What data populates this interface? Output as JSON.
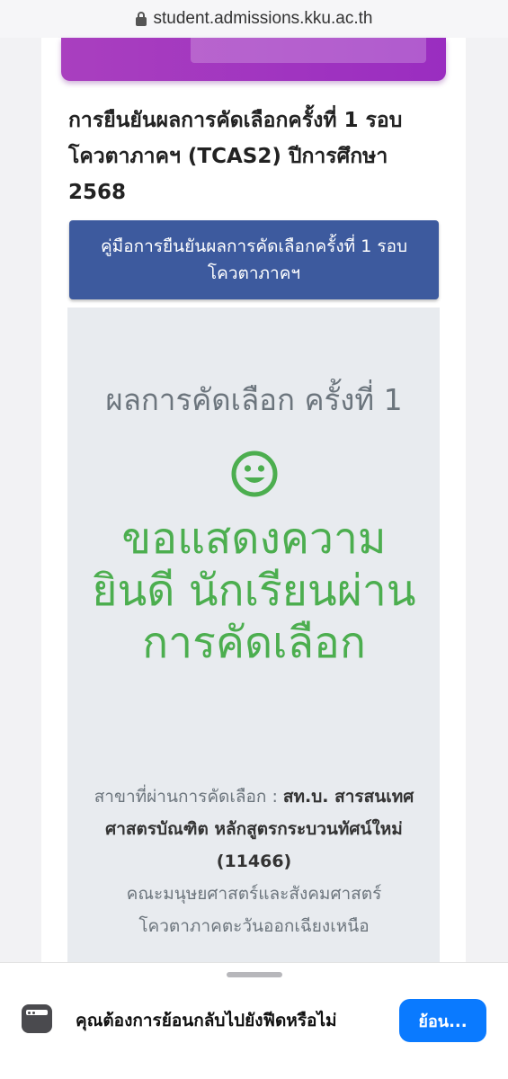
{
  "browser": {
    "url": "student.admissions.kku.ac.th"
  },
  "page": {
    "heading": "การยืนยันผลการคัดเลือกครั้งที่ 1 รอบโควตาภาคฯ (TCAS2) ปีการศึกษา 2568",
    "manual_button": "คู่มือการยืนยันผลการคัดเลือกครั้งที่ 1 รอบโควตาภาคฯ",
    "result_title": "ผลการคัดเลือก ครั้งที่ 1",
    "congrats": "ขอแสดงความยินดี นักเรียนผ่านการคัดเลือก",
    "detail": {
      "label": "สาขาที่ผ่านการคัดเลือก : ",
      "program": "สท.บ. สารสนเทศศาสตรบัณฑิต หลักสูตรกระบวนทัศน์ใหม่ (11466)",
      "faculty": "คณะมนุษยศาสตร์และสังคมศาสตร์",
      "quota": "โควตาภาคตะวันออกเฉียงเหนือ"
    }
  },
  "sheet": {
    "prompt": "คุณต้องการย้อนกลับไปยังฟีดหรือไม่",
    "back_button": "ย้อน..."
  },
  "colors": {
    "banner": "#a93fbf",
    "manual_button": "#3d5a9e",
    "success": "#4cae4f",
    "ios_blue": "#0a7aff"
  }
}
